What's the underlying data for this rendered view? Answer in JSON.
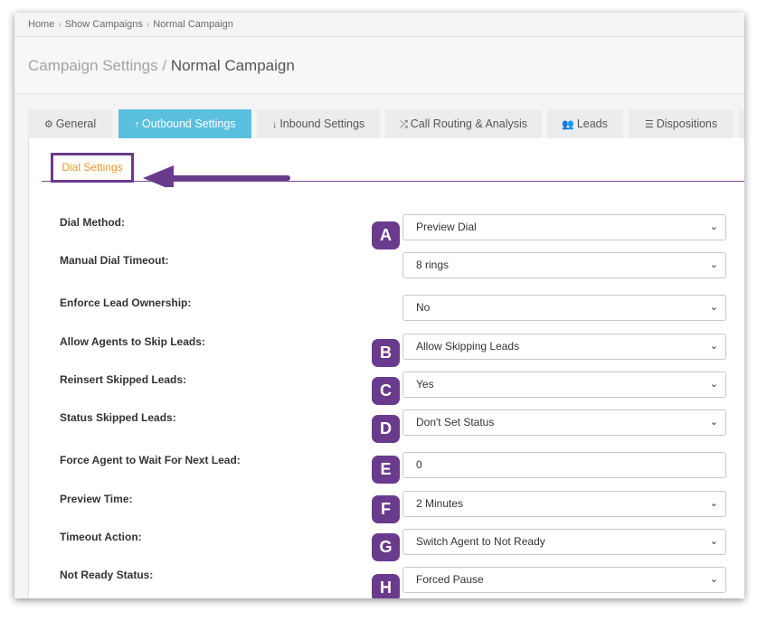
{
  "breadcrumb": [
    "Home",
    "Show Campaigns",
    "Normal Campaign"
  ],
  "header": {
    "title_prefix": "Campaign Settings",
    "title_sep": " / ",
    "title_current": "Normal Campaign"
  },
  "tabs": [
    {
      "label": "General",
      "icon": "gears-icon"
    },
    {
      "label": "Outbound Settings",
      "icon": "arrow-up-icon"
    },
    {
      "label": "Inbound Settings",
      "icon": "arrow-down-icon"
    },
    {
      "label": "Call Routing & Analysis",
      "icon": "shuffle-icon"
    },
    {
      "label": "Leads",
      "icon": "users-icon"
    },
    {
      "label": "Dispositions",
      "icon": "list-icon"
    }
  ],
  "subtab": {
    "label": "Dial Settings"
  },
  "accent": "#6a3b8c",
  "active_tab_color": "#5bc0de",
  "fields": [
    {
      "label": "Dial Method:",
      "value": "Preview Dial",
      "badge": "A"
    },
    {
      "label": "Manual Dial Timeout:",
      "value": "8 rings",
      "badge": ""
    },
    {
      "label": "Enforce Lead Ownership:",
      "value": "No",
      "badge": ""
    },
    {
      "label": "Allow Agents to Skip Leads:",
      "value": "Allow Skipping Leads",
      "badge": "B"
    },
    {
      "label": "Reinsert Skipped Leads:",
      "value": "Yes",
      "badge": "C"
    },
    {
      "label": "Status Skipped Leads:",
      "value": "Don't Set Status",
      "badge": "D"
    },
    {
      "label": "Force Agent to Wait For Next Lead:",
      "value": "0",
      "badge": "E"
    },
    {
      "label": "Preview Time:",
      "value": "2 Minutes",
      "badge": "F"
    },
    {
      "label": "Timeout Action:",
      "value": "Switch Agent to Not Ready",
      "badge": "G"
    },
    {
      "label": "Not Ready Status:",
      "value": "Forced Pause",
      "badge": "H"
    }
  ]
}
